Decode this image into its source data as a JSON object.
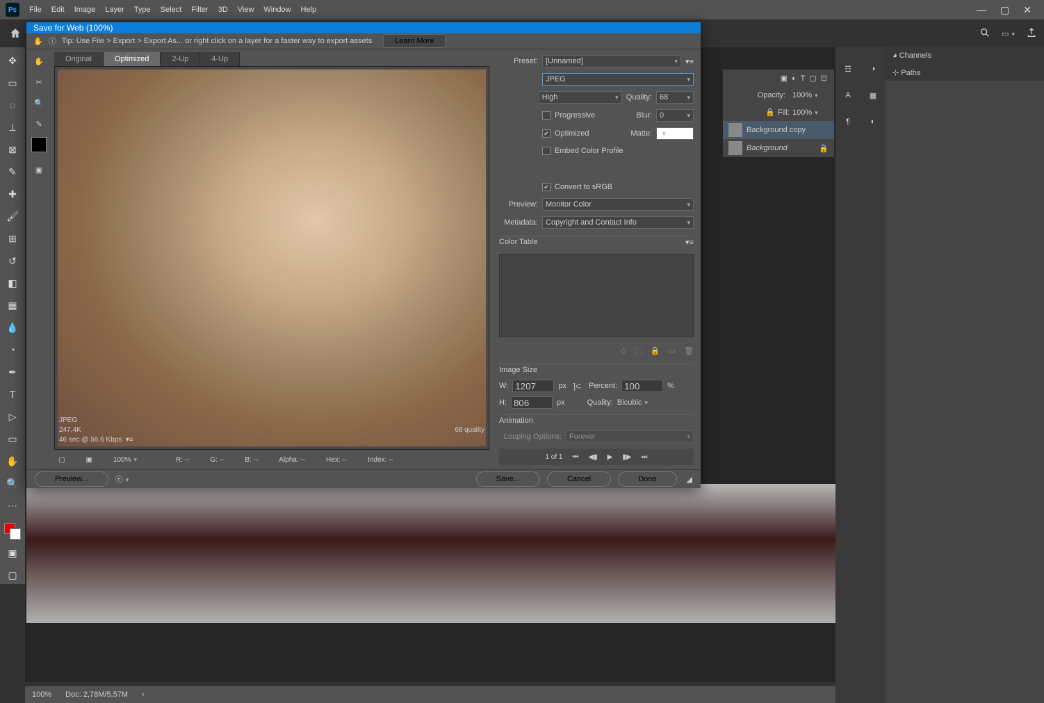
{
  "menubar": {
    "items": [
      "File",
      "Edit",
      "Image",
      "Layer",
      "Type",
      "Select",
      "Filter",
      "3D",
      "View",
      "Window",
      "Help"
    ]
  },
  "dialog": {
    "title": "Save for Web (100%)",
    "tip": "Tip: Use File > Export > Export As...   or right click on a layer for a faster way to export assets",
    "learn": "Learn More",
    "tabs": {
      "a": "Original",
      "b": "Optimized",
      "c": "2-Up",
      "d": "4-Up"
    },
    "info": {
      "fmt": "JPEG",
      "size": "247,4K",
      "speed": "46 sec @ 56.6 Kbps",
      "qual": "68 quality"
    },
    "pxinfo": {
      "r": "R: --",
      "g": "G: --",
      "b": "B: --",
      "alpha": "Alpha: --",
      "hex": "Hex: --",
      "index": "Index: --"
    },
    "zoom": "100%",
    "preset_lbl": "Preset:",
    "preset": "[Unnamed]",
    "format": "JPEG",
    "quality_opt": "High",
    "quality_lbl": "Quality:",
    "quality": "68",
    "progressive": "Progressive",
    "blur_lbl": "Blur:",
    "blur": "0",
    "optimized": "Optimized",
    "matte_lbl": "Matte:",
    "embed": "Embed Color Profile",
    "convert": "Convert to sRGB",
    "preview_lbl": "Preview:",
    "preview": "Monitor Color",
    "meta_lbl": "Metadata:",
    "meta": "Copyright and Contact Info",
    "ct": "Color Table",
    "imgsize": "Image Size",
    "w_lbl": "W:",
    "w": "1207",
    "h_lbl": "H:",
    "h": "806",
    "px": "px",
    "percent_lbl": "Percent:",
    "percent": "100",
    "pct": "%",
    "q2_lbl": "Quality:",
    "q2": "Bicubic",
    "anim": "Animation",
    "loop_lbl": "Looping Options:",
    "loop": "Forever",
    "frame": "1 of 1",
    "preview_btn": "Preview...",
    "save": "Save...",
    "cancel": "Cancel",
    "done": "Done"
  },
  "panels": {
    "channels": "Channels",
    "paths": "Paths",
    "opacity_lbl": "Opacity:",
    "opacity": "100%",
    "fill_lbl": "Fill:",
    "fill": "100%",
    "layer1": "Background copy",
    "layer2": "Background"
  },
  "status": {
    "zoom": "100%",
    "doc": "Doc: 2,78M/5,57M"
  }
}
